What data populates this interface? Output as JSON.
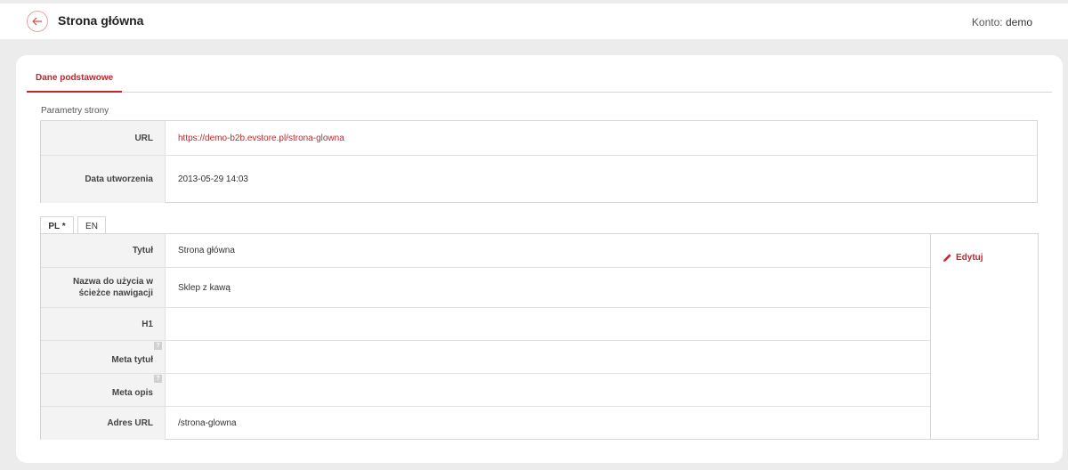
{
  "header": {
    "title": "Strona główna",
    "account_label": "Konto:",
    "account_name": "demo"
  },
  "tabs": {
    "main": "Dane podstawowe"
  },
  "params": {
    "section_label": "Parametry strony",
    "rows": [
      {
        "label": "URL",
        "value": "https://demo-b2b.evstore.pl/strona-glowna"
      },
      {
        "label": "Data utworzenia",
        "value": "2013-05-29 14:03"
      }
    ]
  },
  "lang_tabs": [
    "PL *",
    "EN"
  ],
  "content": {
    "rows": [
      {
        "label": "Tytuł",
        "value": "Strona główna"
      },
      {
        "label": "Nazwa do użycia w ścieżce nawigacji",
        "value": "Sklep z kawą"
      },
      {
        "label": "H1",
        "value": ""
      },
      {
        "label": "Meta tytuł",
        "value": "",
        "help": "?"
      },
      {
        "label": "Meta opis",
        "value": "",
        "help": "?"
      },
      {
        "label": "Adres URL",
        "value": "/strona-glowna"
      }
    ],
    "edit_label": "Edytuj"
  },
  "colors": {
    "accent": "#c0272d",
    "background": "#ececec"
  },
  "icons": {
    "back": "arrow-left-icon",
    "edit": "pencil-icon",
    "help": "question-icon"
  }
}
